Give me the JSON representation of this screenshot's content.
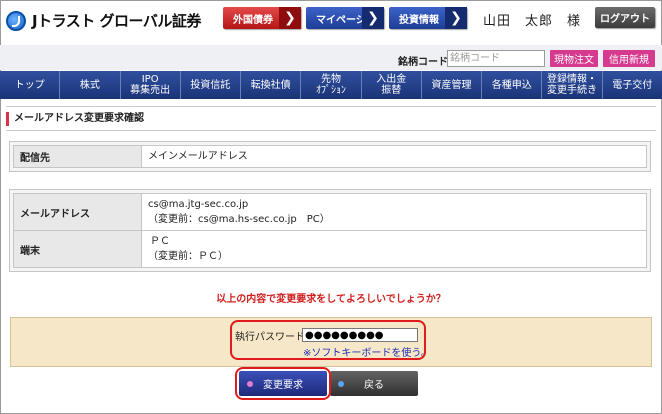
{
  "header": {
    "logo_text": "Jトラスト グローバル証券",
    "buttons": [
      {
        "label": "外国債券"
      },
      {
        "label": "マイページ"
      },
      {
        "label": "投資情報"
      }
    ],
    "user_name": "山田　太郎　様",
    "logout_label": "ログアウト"
  },
  "search": {
    "label": "銘柄コード",
    "placeholder": "銘柄コード",
    "spot_order_label": "現物注文",
    "margin_new_label": "信用新規"
  },
  "nav": {
    "items": [
      {
        "label": "トップ"
      },
      {
        "label": "株式"
      },
      {
        "label": "IPO\n募集売出"
      },
      {
        "label": "投資信託"
      },
      {
        "label": "転換社債"
      },
      {
        "label": "先物\nｵﾌﾟｼｮﾝ"
      },
      {
        "label": "入出金\n振替"
      },
      {
        "label": "資産管理"
      },
      {
        "label": "各種申込"
      },
      {
        "label": "登録情報・\n変更手続き"
      },
      {
        "label": "電子交付"
      }
    ]
  },
  "page": {
    "title": "メールアドレス変更要求確認"
  },
  "delivery": {
    "label": "配信先",
    "value": "メインメールアドレス"
  },
  "details": {
    "email_label": "メールアドレス",
    "email_value": "cs@ma.jtg-sec.co.jp",
    "email_before": "（変更前：cs@ma.hs-sec.co.jp　PC）",
    "device_label": "端末",
    "device_value": "ＰＣ",
    "device_before": "（変更前：ＰＣ）"
  },
  "confirm_message": "以上の内容で変更要求をしてよろしいでしょうか？",
  "password": {
    "label": "執行パスワード",
    "value": "●●●●●●●●●",
    "soft_keyboard_link": "※ソフトキーボードを使う。"
  },
  "actions": {
    "submit_label": "変更要求",
    "back_label": "戻る"
  },
  "colors": {
    "nav_bg": "#1b3478",
    "accent_red": "#d0201d",
    "highlight_border": "#e01b1b",
    "pink_button": "#d63a8f",
    "password_bg": "#f6e7c8"
  }
}
